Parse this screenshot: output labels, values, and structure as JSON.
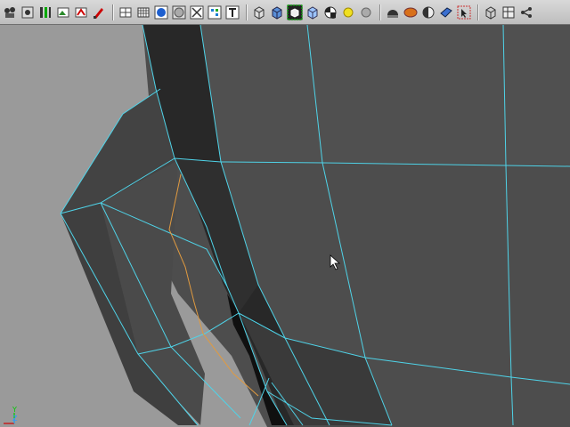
{
  "toolbar": {
    "groups": [
      [
        "select-camera-icon",
        "snap-icon",
        "panel-bars-icon",
        "image-plane-icon",
        "render-icon",
        "paint-icon"
      ],
      [
        "wireframe-icon",
        "grid-icon",
        "shaded-sphere-icon",
        "flat-circle-icon",
        "xray-icon",
        "component-icon",
        "text-icon"
      ],
      [
        "cube-wire-icon",
        "cube-shaded-icon",
        "cube-selected-icon",
        "cube-light-icon",
        "checker-icon",
        "light-yellow-icon",
        "light-grey-icon"
      ],
      [
        "hemisphere-icon",
        "shader-orange-icon",
        "half-sphere-icon",
        "isolate-icon",
        "arrow-select-icon"
      ],
      [
        "cube-small-icon",
        "layout-icon",
        "share-icon"
      ]
    ],
    "active_icon": "cube-selected-icon"
  },
  "viewport": {
    "background": "#9a9a9a",
    "mesh_color": "#444444",
    "wire_color": "#4fd3e8",
    "edge_selected_color": "#e09a40"
  },
  "axis": {
    "y_label": "Y",
    "z_label": "Z",
    "y_color": "#00cc00",
    "z_color": "#3399ff",
    "x_color": "#cc0000"
  }
}
